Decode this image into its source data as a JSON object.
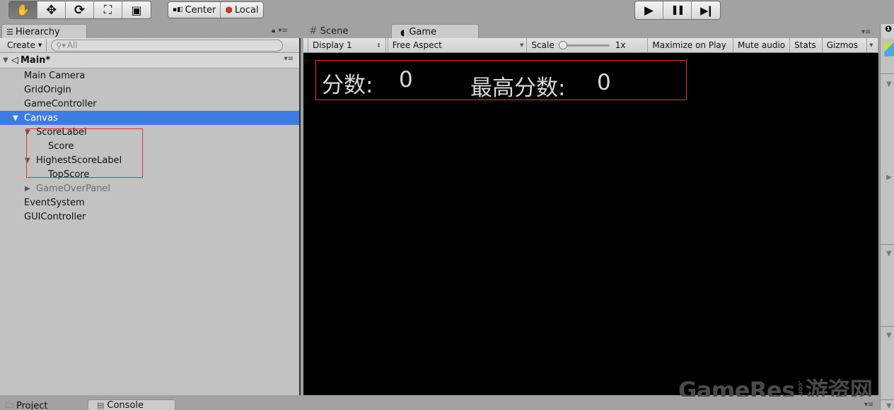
{
  "toolbar": {
    "transform_tools": [
      {
        "name": "hand-tool",
        "icon": "hand-icon",
        "glyph": "✋",
        "active": true
      },
      {
        "name": "move-tool",
        "icon": "move-arrows-icon",
        "glyph": "✥",
        "active": false
      },
      {
        "name": "rotate-tool",
        "icon": "rotate-icon",
        "glyph": "⟳",
        "active": false
      },
      {
        "name": "scale-tool",
        "icon": "scale-icon",
        "glyph": "⛶",
        "active": false
      },
      {
        "name": "rect-tool",
        "icon": "rect-transform-icon",
        "glyph": "▣",
        "active": false
      }
    ],
    "pivot_center_label": "Center",
    "pivot_local_label": "Local",
    "play_glyph": "▶",
    "pause_glyph": "❚❚",
    "step_glyph": "▶❙"
  },
  "hierarchy": {
    "tab_label": "Hierarchy",
    "create_label": "Create",
    "search_placeholder": "All",
    "scene_name": "Main*",
    "items": [
      {
        "label": "Main Camera",
        "depth": 0,
        "expander": "",
        "state": "normal"
      },
      {
        "label": "GridOrigin",
        "depth": 0,
        "expander": "",
        "state": "normal"
      },
      {
        "label": "GameController",
        "depth": 0,
        "expander": "",
        "state": "normal"
      },
      {
        "label": "Canvas",
        "depth": 0,
        "expander": "▼",
        "state": "selected"
      },
      {
        "label": "ScoreLabel",
        "depth": 1,
        "expander": "▼",
        "state": "normal"
      },
      {
        "label": "Score",
        "depth": 2,
        "expander": "",
        "state": "normal"
      },
      {
        "label": "HighestScoreLabel",
        "depth": 1,
        "expander": "▼",
        "state": "normal"
      },
      {
        "label": "TopScore",
        "depth": 2,
        "expander": "",
        "state": "normal"
      },
      {
        "label": "GameOverPanel",
        "depth": 1,
        "expander": "▶",
        "state": "disabled"
      },
      {
        "label": "EventSystem",
        "depth": 0,
        "expander": "",
        "state": "normal"
      },
      {
        "label": "GUIController",
        "depth": 0,
        "expander": "",
        "state": "normal"
      }
    ]
  },
  "game_view": {
    "scene_tab_label": "Scene",
    "game_tab_label": "Game",
    "display_label": "Display 1",
    "aspect_label": "Free Aspect",
    "scale_label": "Scale",
    "scale_value": "1x",
    "scale_slider_fraction": 0.0,
    "maximize_label": "Maximize on Play",
    "mute_label": "Mute audio",
    "stats_label": "Stats",
    "gizmos_label": "Gizmos",
    "score_label": "分数:",
    "score_value": "0",
    "high_score_label": "最高分数:",
    "high_score_value": "0",
    "watermark_main": "GameRes",
    "watermark_dot": ".com",
    "watermark_cn": "游资网"
  },
  "bottom_tabs": {
    "project_label": "Project",
    "console_label": "Console"
  },
  "colors": {
    "selection": "#3e7ce1",
    "highlight_box": "#e03030"
  }
}
